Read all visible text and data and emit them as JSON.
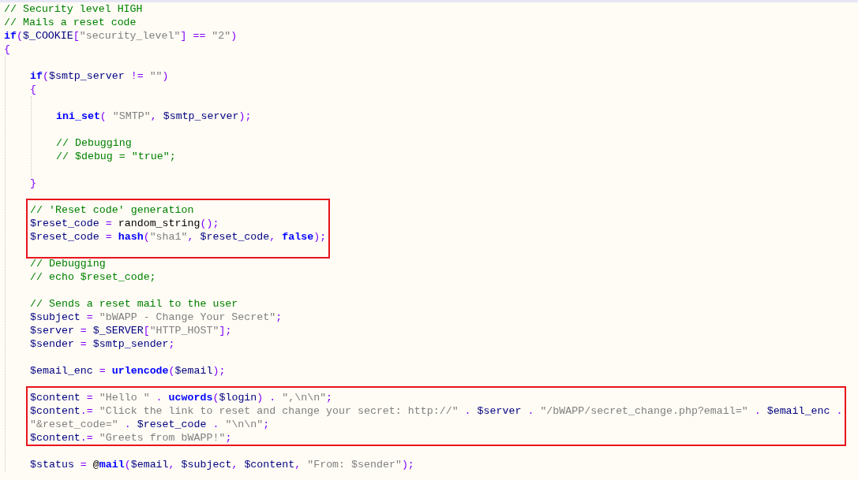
{
  "code": [
    {
      "kind": "line",
      "tokens": [
        {
          "kind": "comment",
          "text": "// Security level HIGH"
        }
      ]
    },
    {
      "kind": "line",
      "tokens": [
        {
          "kind": "comment",
          "text": "// Mails a reset code"
        }
      ]
    },
    {
      "kind": "line",
      "tokens": [
        {
          "kind": "keyword",
          "text": "if"
        },
        {
          "kind": "op",
          "text": "("
        },
        {
          "kind": "var",
          "text": "$_COOKIE"
        },
        {
          "kind": "op",
          "text": "["
        },
        {
          "kind": "string",
          "text": "\"security_level\""
        },
        {
          "kind": "op",
          "text": "] == "
        },
        {
          "kind": "string",
          "text": "\"2\""
        },
        {
          "kind": "op",
          "text": ")"
        }
      ]
    },
    {
      "kind": "line",
      "tokens": [
        {
          "kind": "op",
          "text": "{"
        }
      ],
      "children": [
        {
          "kind": "blank"
        },
        {
          "kind": "line",
          "tokens": [
            {
              "kind": "keyword",
              "text": "if"
            },
            {
              "kind": "op",
              "text": "("
            },
            {
              "kind": "var",
              "text": "$smtp_server"
            },
            {
              "kind": "op",
              "text": " != "
            },
            {
              "kind": "string",
              "text": "\"\""
            },
            {
              "kind": "op",
              "text": ")"
            }
          ]
        },
        {
          "kind": "line",
          "tokens": [
            {
              "kind": "op",
              "text": "{"
            }
          ],
          "children": [
            {
              "kind": "blank"
            },
            {
              "kind": "line",
              "tokens": [
                {
                  "kind": "keyword",
                  "text": "ini_set"
                },
                {
                  "kind": "op",
                  "text": "( "
                },
                {
                  "kind": "string",
                  "text": "\"SMTP\""
                },
                {
                  "kind": "op",
                  "text": ", "
                },
                {
                  "kind": "var",
                  "text": "$smtp_server"
                },
                {
                  "kind": "op",
                  "text": ");"
                }
              ]
            },
            {
              "kind": "blank"
            },
            {
              "kind": "line",
              "tokens": [
                {
                  "kind": "comment",
                  "text": "// Debugging"
                }
              ]
            },
            {
              "kind": "line",
              "tokens": [
                {
                  "kind": "comment",
                  "text": "// $debug = \"true\";"
                }
              ]
            },
            {
              "kind": "blank"
            }
          ]
        },
        {
          "kind": "line",
          "tokens": [
            {
              "kind": "op",
              "text": "}"
            }
          ]
        },
        {
          "kind": "blank"
        },
        {
          "kind": "highlight",
          "lines": [
            {
              "kind": "line",
              "tokens": [
                {
                  "kind": "comment",
                  "text": "// 'Reset code' generation"
                }
              ]
            },
            {
              "kind": "line",
              "tokens": [
                {
                  "kind": "var",
                  "text": "$reset_code"
                },
                {
                  "kind": "op",
                  "text": " = "
                },
                {
                  "kind": "plain",
                  "text": "random_string"
                },
                {
                  "kind": "op",
                  "text": "();"
                }
              ]
            },
            {
              "kind": "line",
              "tokens": [
                {
                  "kind": "var",
                  "text": "$reset_code"
                },
                {
                  "kind": "op",
                  "text": " = "
                },
                {
                  "kind": "keyword",
                  "text": "hash"
                },
                {
                  "kind": "op",
                  "text": "("
                },
                {
                  "kind": "string",
                  "text": "\"sha1\""
                },
                {
                  "kind": "op",
                  "text": ", "
                },
                {
                  "kind": "var",
                  "text": "$reset_code"
                },
                {
                  "kind": "op",
                  "text": ", "
                },
                {
                  "kind": "keyword",
                  "text": "false"
                },
                {
                  "kind": "op",
                  "text": ");"
                }
              ]
            },
            {
              "kind": "blank"
            }
          ]
        },
        {
          "kind": "line",
          "tokens": [
            {
              "kind": "comment",
              "text": "// Debugging"
            }
          ]
        },
        {
          "kind": "line",
          "tokens": [
            {
              "kind": "comment",
              "text": "// echo $reset_code;"
            }
          ]
        },
        {
          "kind": "blank"
        },
        {
          "kind": "line",
          "tokens": [
            {
              "kind": "comment",
              "text": "// Sends a reset mail to the user"
            }
          ]
        },
        {
          "kind": "line",
          "tokens": [
            {
              "kind": "var",
              "text": "$subject"
            },
            {
              "kind": "op",
              "text": " = "
            },
            {
              "kind": "string",
              "text": "\"bWAPP - Change Your Secret\""
            },
            {
              "kind": "op",
              "text": ";"
            }
          ]
        },
        {
          "kind": "line",
          "tokens": [
            {
              "kind": "var",
              "text": "$server"
            },
            {
              "kind": "op",
              "text": " = "
            },
            {
              "kind": "var",
              "text": "$_SERVER"
            },
            {
              "kind": "op",
              "text": "["
            },
            {
              "kind": "string",
              "text": "\"HTTP_HOST\""
            },
            {
              "kind": "op",
              "text": "];"
            }
          ]
        },
        {
          "kind": "line",
          "tokens": [
            {
              "kind": "var",
              "text": "$sender"
            },
            {
              "kind": "op",
              "text": " = "
            },
            {
              "kind": "var",
              "text": "$smtp_sender"
            },
            {
              "kind": "op",
              "text": ";"
            }
          ]
        },
        {
          "kind": "blank"
        },
        {
          "kind": "line",
          "tokens": [
            {
              "kind": "var",
              "text": "$email_enc"
            },
            {
              "kind": "op",
              "text": " = "
            },
            {
              "kind": "keyword",
              "text": "urlencode"
            },
            {
              "kind": "op",
              "text": "("
            },
            {
              "kind": "var",
              "text": "$email"
            },
            {
              "kind": "op",
              "text": ");"
            }
          ]
        },
        {
          "kind": "blank"
        },
        {
          "kind": "highlight",
          "lines": [
            {
              "kind": "line",
              "tokens": [
                {
                  "kind": "var",
                  "text": "$content"
                },
                {
                  "kind": "op",
                  "text": " = "
                },
                {
                  "kind": "string",
                  "text": "\"Hello \""
                },
                {
                  "kind": "op",
                  "text": " . "
                },
                {
                  "kind": "keyword",
                  "text": "ucwords"
                },
                {
                  "kind": "op",
                  "text": "("
                },
                {
                  "kind": "var",
                  "text": "$login"
                },
                {
                  "kind": "op",
                  "text": ") . "
                },
                {
                  "kind": "string",
                  "text": "\",\\n\\n\""
                },
                {
                  "kind": "op",
                  "text": ";"
                }
              ]
            },
            {
              "kind": "line",
              "tokens": [
                {
                  "kind": "var",
                  "text": "$content"
                },
                {
                  "kind": "op",
                  "text": ".= "
                },
                {
                  "kind": "string",
                  "text": "\"Click the link to reset and change your secret: http://\""
                },
                {
                  "kind": "op",
                  "text": " . "
                },
                {
                  "kind": "var",
                  "text": "$server"
                },
                {
                  "kind": "op",
                  "text": " . "
                },
                {
                  "kind": "string",
                  "text": "\"/bWAPP/secret_change.php?email=\""
                },
                {
                  "kind": "op",
                  "text": " . "
                },
                {
                  "kind": "var",
                  "text": "$email_enc"
                },
                {
                  "kind": "op",
                  "text": " ."
                }
              ]
            },
            {
              "kind": "line",
              "tokens": [
                {
                  "kind": "string",
                  "text": "\"&reset_code=\""
                },
                {
                  "kind": "op",
                  "text": " . "
                },
                {
                  "kind": "var",
                  "text": "$reset_code"
                },
                {
                  "kind": "op",
                  "text": " . "
                },
                {
                  "kind": "string",
                  "text": "\"\\n\\n\""
                },
                {
                  "kind": "op",
                  "text": ";"
                }
              ]
            },
            {
              "kind": "line",
              "tokens": [
                {
                  "kind": "var",
                  "text": "$content"
                },
                {
                  "kind": "op",
                  "text": ".= "
                },
                {
                  "kind": "string",
                  "text": "\"Greets from bWAPP!\""
                },
                {
                  "kind": "op",
                  "text": ";"
                }
              ]
            }
          ]
        },
        {
          "kind": "blank"
        },
        {
          "kind": "line",
          "tokens": [
            {
              "kind": "var",
              "text": "$status"
            },
            {
              "kind": "op",
              "text": " = "
            },
            {
              "kind": "plain",
              "text": "@"
            },
            {
              "kind": "keyword",
              "text": "mail"
            },
            {
              "kind": "op",
              "text": "("
            },
            {
              "kind": "var",
              "text": "$email"
            },
            {
              "kind": "op",
              "text": ", "
            },
            {
              "kind": "var",
              "text": "$subject"
            },
            {
              "kind": "op",
              "text": ", "
            },
            {
              "kind": "var",
              "text": "$content"
            },
            {
              "kind": "op",
              "text": ", "
            },
            {
              "kind": "string",
              "text": "\"From: $sender\""
            },
            {
              "kind": "op",
              "text": ");"
            }
          ]
        }
      ]
    }
  ]
}
